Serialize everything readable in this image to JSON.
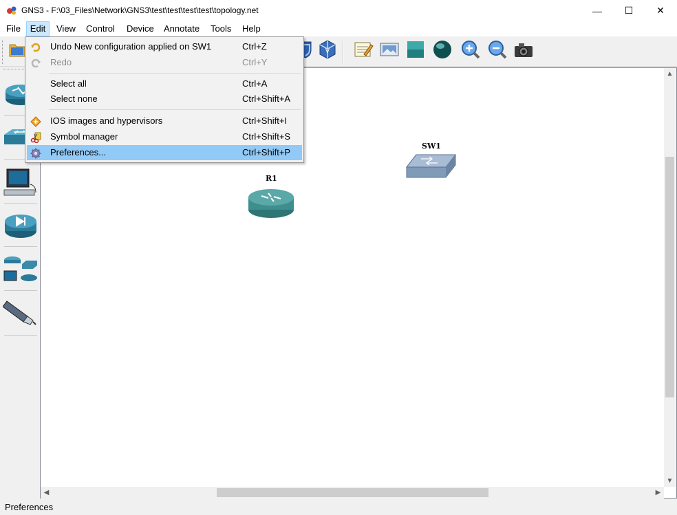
{
  "window": {
    "title": "GNS3 - F:\\03_Files\\Network\\GNS3\\test\\test\\test\\test\\topology.net",
    "minimize_glyph": "—",
    "maximize_glyph": "☐",
    "close_glyph": "✕"
  },
  "menubar": {
    "items": [
      {
        "label": "File"
      },
      {
        "label": "Edit",
        "open": true
      },
      {
        "label": "View"
      },
      {
        "label": "Control"
      },
      {
        "label": "Device"
      },
      {
        "label": "Annotate"
      },
      {
        "label": "Tools"
      },
      {
        "label": "Help"
      }
    ]
  },
  "edit_menu": {
    "items": [
      {
        "label": "Undo New configuration applied on SW1",
        "shortcut": "Ctrl+Z",
        "icon": "undo-icon",
        "enabled": true
      },
      {
        "label": "Redo",
        "shortcut": "Ctrl+Y",
        "icon": "redo-icon",
        "enabled": false
      },
      {
        "label": "Select all",
        "shortcut": "Ctrl+A",
        "enabled": true
      },
      {
        "label": "Select none",
        "shortcut": "Ctrl+Shift+A",
        "enabled": true
      },
      {
        "label": "IOS images and hypervisors",
        "shortcut": "Ctrl+Shift+I",
        "icon": "ios-images-icon",
        "enabled": true
      },
      {
        "label": "Symbol manager",
        "shortcut": "Ctrl+Shift+S",
        "icon": "symbol-manager-icon",
        "enabled": true
      },
      {
        "label": "Preferences...",
        "shortcut": "Ctrl+Shift+P",
        "icon": "preferences-gear-icon",
        "enabled": true,
        "highlighted": true
      }
    ]
  },
  "toolbar": {
    "icons": [
      "open-project-icon",
      "virtualbox-shield-icon",
      "virtualbox-cube-icon",
      "add-note-icon",
      "insert-picture-icon",
      "draw-rectangle-icon",
      "draw-ellipse-icon",
      "zoom-in-icon",
      "zoom-out-icon",
      "screenshot-camera-icon"
    ]
  },
  "device_dock": {
    "items": [
      "router-icon",
      "switch-icon",
      "end-device-icon",
      "security-device-icon",
      "all-devices-icon",
      "ethernet-link-icon"
    ]
  },
  "topology": {
    "nodes": [
      {
        "name": "SW1",
        "type": "switch"
      },
      {
        "name": "R1",
        "type": "router"
      }
    ]
  },
  "colors": {
    "menu_open_bg": "#cce8ff",
    "menu_highlight_bg": "#91c9f7",
    "router_teal": "#3e8e8e",
    "switch_blue": "#7f9bb8"
  },
  "statusbar": {
    "text": "Preferences"
  }
}
